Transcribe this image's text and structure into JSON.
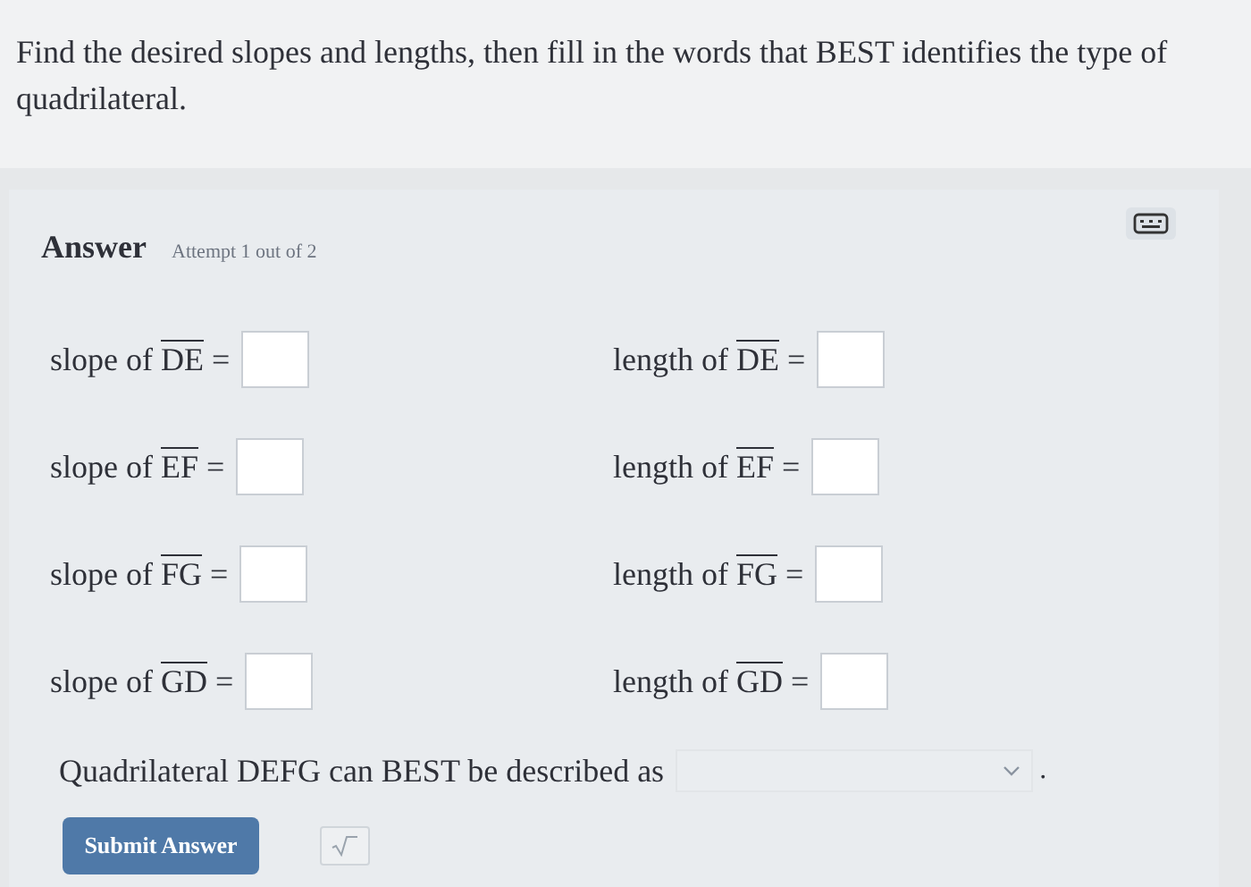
{
  "question": "Find the desired slopes and lengths, then fill in the words that BEST identifies the type of quadrilateral.",
  "answer": {
    "title": "Answer",
    "attempt": "Attempt 1 out of 2"
  },
  "rows": [
    {
      "left": {
        "label": "slope of",
        "segment": "DE",
        "sign": "="
      },
      "right": {
        "label": "length of",
        "segment": "DE",
        "sign": "="
      }
    },
    {
      "left": {
        "label": "slope of",
        "segment": "EF",
        "sign": "="
      },
      "right": {
        "label": "length of",
        "segment": "EF",
        "sign": "="
      }
    },
    {
      "left": {
        "label": "slope of",
        "segment": "FG",
        "sign": "="
      },
      "right": {
        "label": "length of",
        "segment": "FG",
        "sign": "="
      }
    },
    {
      "left": {
        "label": "slope of",
        "segment": "GD",
        "sign": "="
      },
      "right": {
        "label": "length of",
        "segment": "GD",
        "sign": "="
      }
    }
  ],
  "sentence": {
    "text": "Quadrilateral DEFG can BEST be described as",
    "end": "."
  },
  "submit": "Submit Answer"
}
